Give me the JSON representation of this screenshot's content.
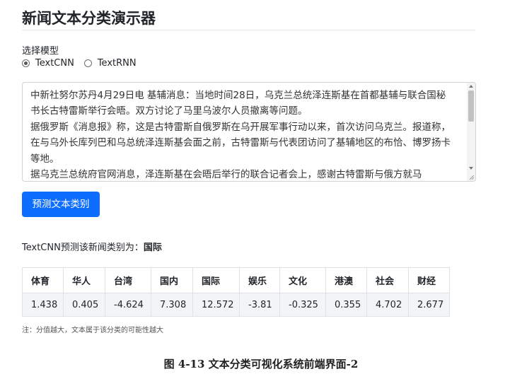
{
  "page": {
    "title": "新闻文本分类演示器"
  },
  "model_select": {
    "label": "选择模型",
    "options": [
      "TextCNN",
      "TextRNN"
    ],
    "selected": "TextCNN"
  },
  "input_text": "中新社努尔苏丹4月29日电 基辅消息：当地时间28日，乌克兰总统泽连斯基在首都基辅与联合国秘书长古特雷斯举行会晤。双方讨论了马里乌波尔人员撤离等问题。\n据俄罗斯《消息报》称，这是古特雷斯自俄罗斯在乌开展军事行动以来，首次访问乌克兰。报道称，在与乌外长库列巴和乌总统泽连斯基会面之前，古特雷斯与代表团访问了基辅地区的布恰、博罗扬卡等地。\n据乌克兰总统府官网消息，泽连斯基在会晤后举行的联合记者会上，感谢古特雷斯与俄方就马",
  "predict_button": "预测文本类别",
  "result": {
    "prefix": "TextCNN预测该新闻类别为：",
    "category": "国际"
  },
  "table": {
    "headers": [
      "体育",
      "华人",
      "台湾",
      "国内",
      "国际",
      "娱乐",
      "文化",
      "港澳",
      "社会",
      "财经"
    ],
    "values": [
      "1.438",
      "0.405",
      "-4.624",
      "7.308",
      "12.572",
      "-3.81",
      "-0.325",
      "0.355",
      "4.702",
      "2.677"
    ]
  },
  "note": "注：分值越大，文本属于该分类的可能性越大",
  "caption": "图 4-13  文本分类可视化系统前端界面-2",
  "colors": {
    "button": "#0d6efd",
    "table_row_bg": "#f2f5f8"
  }
}
